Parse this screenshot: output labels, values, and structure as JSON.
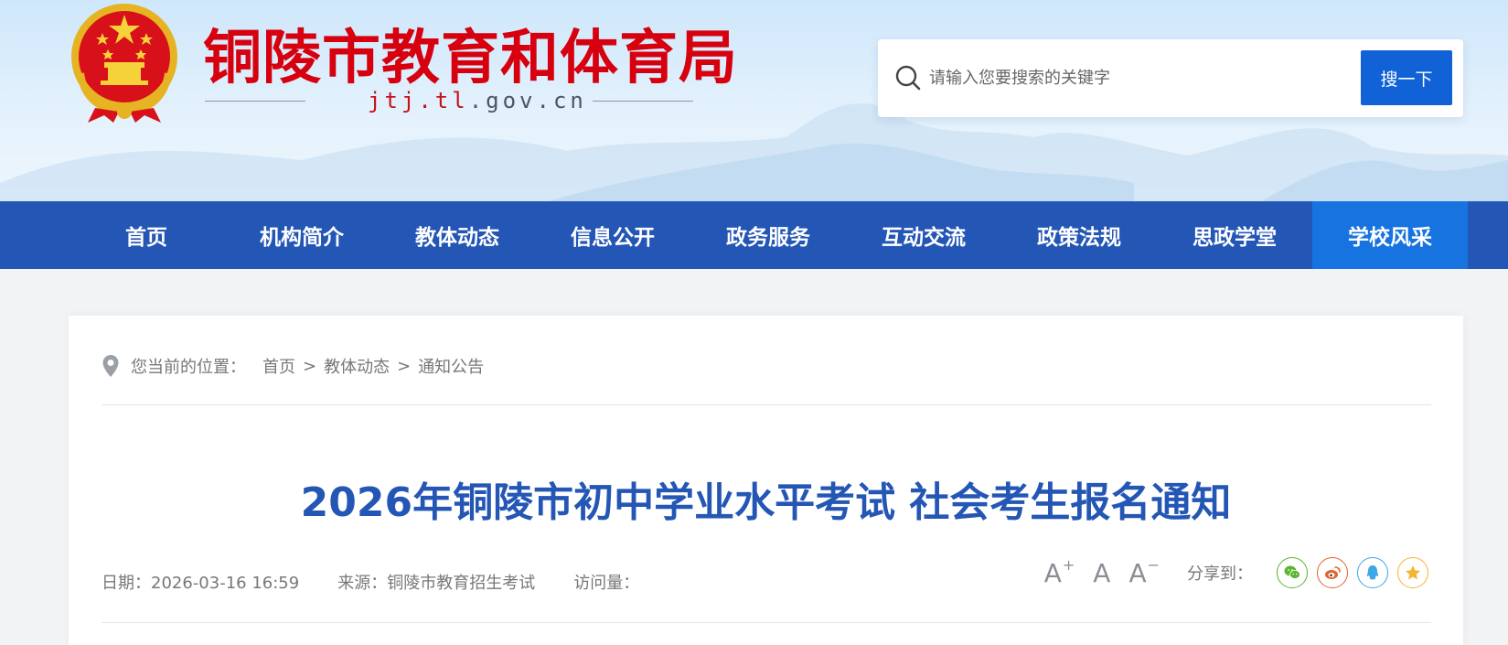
{
  "header": {
    "site_title": "铜陵市教育和体育局",
    "domain_red": "jtj.tl",
    "domain_gray": ".gov.cn"
  },
  "search": {
    "placeholder": "请输入您要搜索的关键字",
    "button_label": "搜一下"
  },
  "nav": {
    "items": [
      {
        "label": "首页"
      },
      {
        "label": "机构简介"
      },
      {
        "label": "教体动态"
      },
      {
        "label": "信息公开"
      },
      {
        "label": "政务服务"
      },
      {
        "label": "互动交流"
      },
      {
        "label": "政策法规"
      },
      {
        "label": "思政学堂"
      },
      {
        "label": "学校风采",
        "active": true
      }
    ]
  },
  "breadcrumb": {
    "label": "您当前的位置：",
    "items": [
      "首页",
      "教体动态",
      "通知公告"
    ],
    "separator": ">"
  },
  "article": {
    "title": "2026年铜陵市初中学业水平考试 社会考生报名通知",
    "date": "日期：2026-03-16 16:59",
    "source": "来源：铜陵市教育招生考试",
    "views": "访问量："
  },
  "tools": {
    "font_large": "A",
    "font_large_sup": "+",
    "font_normal": "A",
    "font_small": "A",
    "font_small_sup": "−",
    "share_label": "分享到："
  },
  "share": [
    {
      "icon": "wechat-icon",
      "color": "#5cb531"
    },
    {
      "icon": "weibo-icon",
      "color": "#e8612c"
    },
    {
      "icon": "qq-icon",
      "color": "#3ea7e8"
    },
    {
      "icon": "qzone-icon",
      "color": "#f3b531"
    }
  ],
  "colors": {
    "brand_red": "#d7000f",
    "nav_blue": "#2456b5",
    "nav_active": "#1673e0",
    "search_button": "#1162d6",
    "title_blue": "#2456b5"
  }
}
